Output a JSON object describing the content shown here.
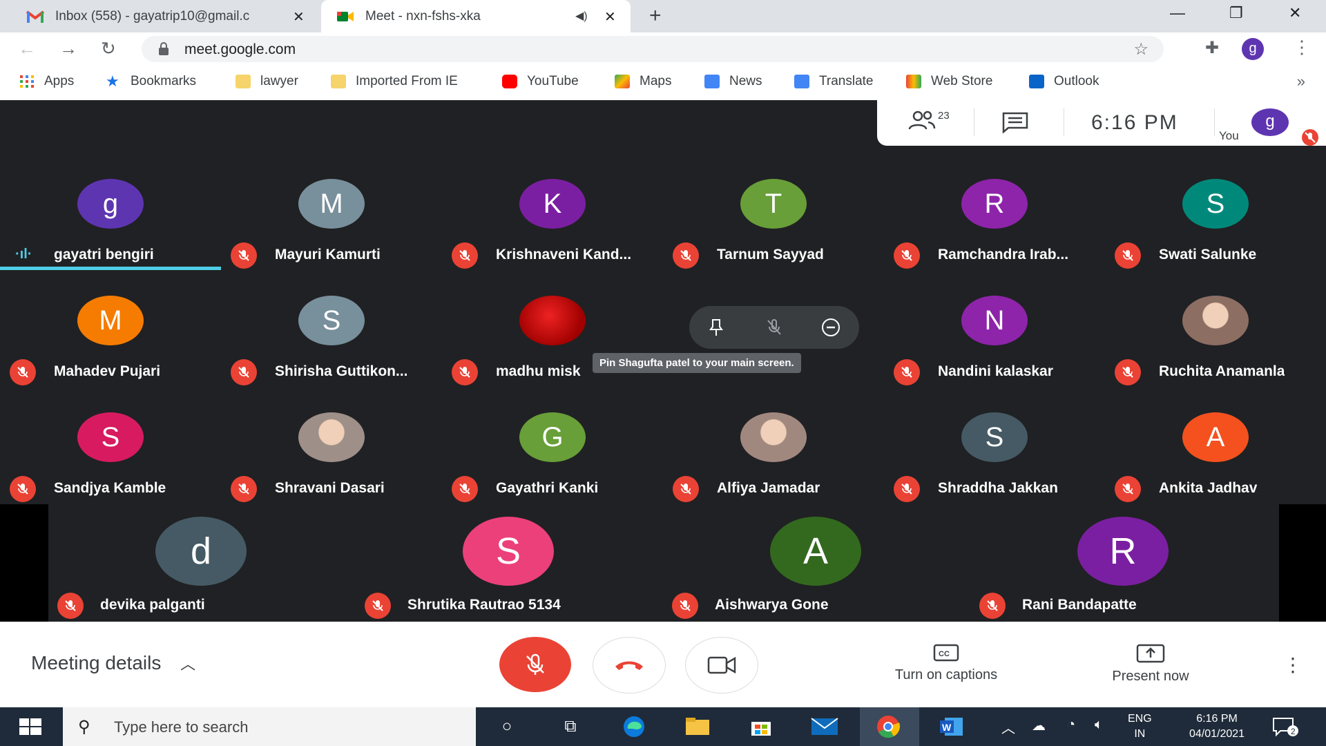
{
  "browser": {
    "tabs": [
      {
        "title": "Inbox (558) - gayatrip10@gmail.c",
        "active": false,
        "icon": "gmail-icon"
      },
      {
        "title": "Meet - nxn-fshs-xka",
        "active": true,
        "icon": "meet-icon"
      }
    ],
    "url": "meet.google.com",
    "profile_initial": "g",
    "bookmarks": [
      {
        "label": "Apps",
        "icon": "apps-grid-icon",
        "color": "#ea4335"
      },
      {
        "label": "Bookmarks",
        "icon": "star-icon",
        "color": "#1a73e8"
      },
      {
        "label": "lawyer",
        "icon": "folder-icon",
        "color": "#f6d36b"
      },
      {
        "label": "Imported From IE",
        "icon": "folder-icon",
        "color": "#f6d36b"
      },
      {
        "label": "YouTube",
        "icon": "youtube-icon",
        "color": "#ff0000"
      },
      {
        "label": "Maps",
        "icon": "maps-icon",
        "color": "#34a853"
      },
      {
        "label": "News",
        "icon": "news-icon",
        "color": "#4285f4"
      },
      {
        "label": "Translate",
        "icon": "translate-icon",
        "color": "#4285f4"
      },
      {
        "label": "Web Store",
        "icon": "webstore-icon",
        "color": "#e94235"
      },
      {
        "label": "Outlook",
        "icon": "outlook-icon",
        "color": "#0a64c8"
      }
    ]
  },
  "meet": {
    "participant_count": "23",
    "time": "6:16  PM",
    "you_label": "You",
    "you_initial": "g",
    "hover_tooltip": "Pin Shagufta patel to your main screen.",
    "participants": [
      {
        "name": "gayatri bengiri",
        "initial": "g",
        "color": "#5e35b1",
        "muted": false,
        "speaking": true
      },
      {
        "name": "Mayuri Kamurti",
        "initial": "M",
        "color": "#78909c",
        "muted": true
      },
      {
        "name": "Krishnaveni Kand...",
        "initial": "K",
        "color": "#7b1fa2",
        "muted": true
      },
      {
        "name": "Tarnum Sayyad",
        "initial": "T",
        "color": "#689f38",
        "muted": true
      },
      {
        "name": "Ramchandra Irab...",
        "initial": "R",
        "color": "#8e24aa",
        "muted": true
      },
      {
        "name": "Swati Salunke",
        "initial": "S",
        "color": "#00897b",
        "muted": true
      },
      {
        "name": "Mahadev Pujari",
        "initial": "M",
        "color": "#f57c00",
        "muted": true
      },
      {
        "name": "Shirisha Guttikon...",
        "initial": "S",
        "color": "#78909c",
        "muted": true
      },
      {
        "name": "madhu misk",
        "initial": "",
        "color": "#b00000",
        "muted": true,
        "photo": true
      },
      {
        "name": "",
        "initial": "",
        "color": "#3c4043",
        "muted": true
      },
      {
        "name": "Nandini kalaskar",
        "initial": "N",
        "color": "#8e24aa",
        "muted": true
      },
      {
        "name": "Ruchita Anamanla",
        "initial": "",
        "color": "#8d6e63",
        "muted": true,
        "photo": true
      },
      {
        "name": "Sandjya Kamble",
        "initial": "S",
        "color": "#d81b60",
        "muted": true
      },
      {
        "name": "Shravani Dasari",
        "initial": "",
        "color": "#9e8f88",
        "muted": true,
        "photo": true
      },
      {
        "name": "Gayathri Kanki",
        "initial": "G",
        "color": "#689f38",
        "muted": true
      },
      {
        "name": "Alfiya Jamadar",
        "initial": "",
        "color": "#a1887f",
        "muted": true,
        "photo": true
      },
      {
        "name": "Shraddha Jakkan",
        "initial": "S",
        "color": "#455a64",
        "muted": true
      },
      {
        "name": "Ankita Jadhav",
        "initial": "A",
        "color": "#f4511e",
        "muted": true
      },
      {
        "name": "devika palganti",
        "initial": "d",
        "color": "#455a64",
        "muted": true
      },
      {
        "name": "Shrutika Rautrao 5134",
        "initial": "S",
        "color": "#ec407a",
        "muted": true
      },
      {
        "name": "Aishwarya Gone",
        "initial": "A",
        "color": "#33691e",
        "muted": true
      },
      {
        "name": "Rani Bandapatte",
        "initial": "R",
        "color": "#7b1fa2",
        "muted": true
      }
    ],
    "bottom": {
      "meeting_details": "Meeting details",
      "captions": "Turn on captions",
      "present": "Present now"
    }
  },
  "taskbar": {
    "search_placeholder": "Type here to search",
    "lang_top": "ENG",
    "lang_bottom": "IN",
    "time": "6:16 PM",
    "date": "04/01/2021",
    "notification_count": "2"
  }
}
